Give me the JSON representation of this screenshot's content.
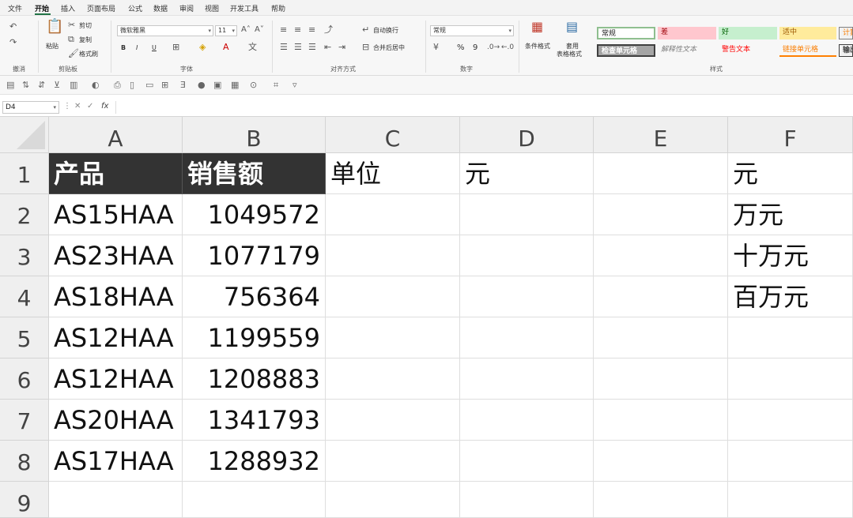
{
  "menu": {
    "items": [
      "文件",
      "开始",
      "插入",
      "页面布局",
      "公式",
      "数据",
      "审阅",
      "视图",
      "开发工具",
      "帮助"
    ],
    "active": "开始"
  },
  "ribbon": {
    "undo_group_label": "撤消",
    "clipboard": {
      "paste": "粘贴",
      "cut": "剪切",
      "copy": "复制",
      "format_painter": "格式刷",
      "label": "剪贴板"
    },
    "font": {
      "name": "微软雅黑",
      "size": "11",
      "bold": "B",
      "italic": "I",
      "underline": "U",
      "label": "字体"
    },
    "alignment": {
      "wrap": "自动换行",
      "merge": "合并后居中",
      "label": "对齐方式"
    },
    "number": {
      "format": "常规",
      "percent": "%",
      "comma": "9",
      "label": "数字"
    },
    "styles": {
      "conditional": "条件格式",
      "table_line1": "套用",
      "table_line2": "表格格式",
      "cells": [
        "常规",
        "差",
        "好",
        "适中",
        "计算",
        "检查单元格",
        "解释性文本",
        "警告文本",
        "链接单元格",
        "输出"
      ],
      "label": "样式"
    }
  },
  "formula_bar": {
    "name_box": "D4",
    "fx": "fx",
    "formula": ""
  },
  "columns": [
    "A",
    "B",
    "C",
    "D",
    "E",
    "F"
  ],
  "rows": [
    "1",
    "2",
    "3",
    "4",
    "5",
    "6",
    "7",
    "8",
    "9"
  ],
  "sheet": {
    "headers": [
      "产品",
      "销售额"
    ],
    "data": [
      {
        "product": "AS15HAA",
        "sales": "1049572"
      },
      {
        "product": "AS23HAA",
        "sales": "1077179"
      },
      {
        "product": "AS18HAA",
        "sales": "756364"
      },
      {
        "product": "AS12HAA",
        "sales": "1199559"
      },
      {
        "product": "AS12HAA",
        "sales": "1208883"
      },
      {
        "product": "AS20HAA",
        "sales": "1341793"
      },
      {
        "product": "AS17HAA",
        "sales": "1288932"
      }
    ],
    "c1": "单位",
    "d1": "元",
    "units": [
      "元",
      "万元",
      "十万元",
      "百万元"
    ]
  },
  "colors": {
    "header_bg": "#333333",
    "accent": "#217346"
  }
}
